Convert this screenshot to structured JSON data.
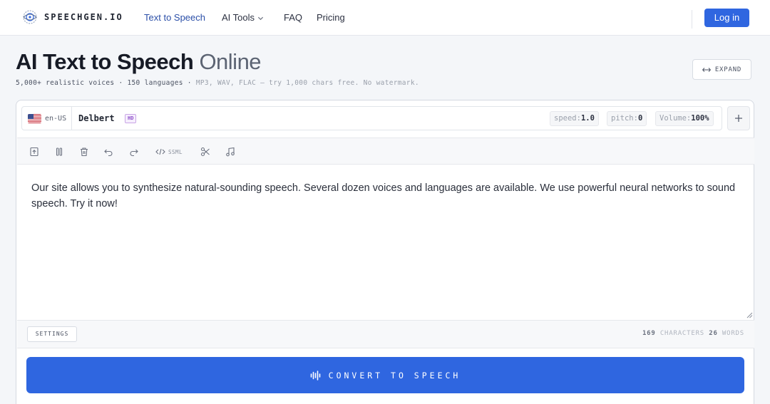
{
  "nav": {
    "logo_text": "SPEECHGEN.IO",
    "links": [
      {
        "label": "Text to Speech",
        "active": true
      },
      {
        "label": "AI Tools",
        "dropdown": true
      },
      {
        "label": "FAQ"
      },
      {
        "label": "Pricing"
      }
    ],
    "login_label": "Log in"
  },
  "hero": {
    "title_main": "AI Text to Speech",
    "title_light": "Online",
    "subtitle_strong": "5,000+ realistic voices · 150 languages ·",
    "subtitle_dim": "MP3, WAV, FLAC — try 1,000 chars free. No watermark.",
    "expand_label": "EXPAND"
  },
  "voice": {
    "lang_code": "en-US",
    "name": "Delbert",
    "badge": "HD",
    "speed_label": "speed:",
    "speed_value": "1.0",
    "pitch_label": "pitch:",
    "pitch_value": "0",
    "volume_label": "Volume:",
    "volume_value": "100%"
  },
  "toolbar": {
    "ssml_label": "SSML",
    "icons": [
      "upload-icon",
      "pause-icon",
      "trash-icon",
      "undo-icon",
      "redo-icon",
      "ssml-code-icon",
      "scissors-icon",
      "music-note-icon"
    ]
  },
  "editor": {
    "text": "Our site allows you to synthesize natural-sounding speech. Several dozen voices and languages are available. We use powerful neural networks to sound speech. Try it now!"
  },
  "footer": {
    "settings_label": "SETTINGS",
    "char_count": "169",
    "char_label": "CHARACTERS",
    "word_count": "26",
    "word_label": "WORDS"
  },
  "convert": {
    "label": "CONVERT TO SPEECH"
  },
  "colors": {
    "accent": "#2f66e0",
    "active_link": "#2b4fa8",
    "hd_badge": "#8d4fc9"
  }
}
